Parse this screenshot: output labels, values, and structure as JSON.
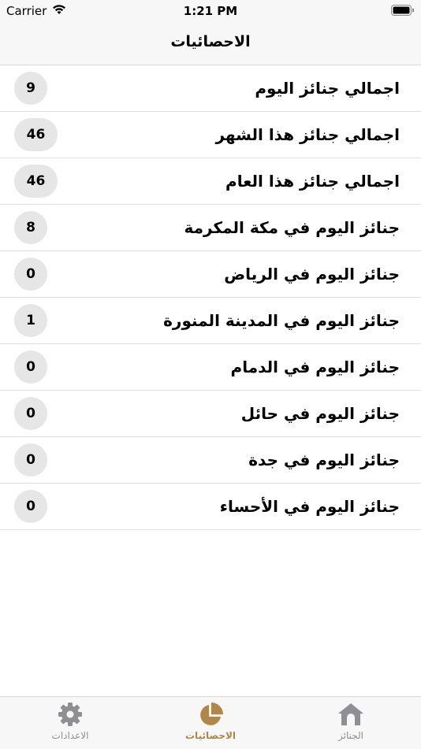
{
  "status_bar": {
    "carrier": "Carrier",
    "time": "1:21 PM"
  },
  "nav": {
    "title": "الاحصائيات"
  },
  "stats": [
    {
      "label": "اجمالي جنائز اليوم",
      "value": "9"
    },
    {
      "label": "اجمالي جنائز هذا الشهر",
      "value": "46"
    },
    {
      "label": "اجمالي جنائز هذا العام",
      "value": "46"
    },
    {
      "label": "جنائز اليوم في مكة المكرمة",
      "value": "8"
    },
    {
      "label": "جنائز اليوم في الرياض",
      "value": "0"
    },
    {
      "label": "جنائز اليوم في المدينة المنورة",
      "value": "1"
    },
    {
      "label": "جنائز اليوم في الدمام",
      "value": "0"
    },
    {
      "label": "جنائز اليوم في حائل",
      "value": "0"
    },
    {
      "label": "جنائز اليوم في جدة",
      "value": "0"
    },
    {
      "label": "جنائز اليوم في الأحساء",
      "value": "0"
    }
  ],
  "tabs": [
    {
      "label": "الاعدادات",
      "icon": "gear-icon"
    },
    {
      "label": "الاحصائيات",
      "icon": "pie-chart-icon",
      "active": true
    },
    {
      "label": "الجنائز",
      "icon": "home-icon"
    }
  ],
  "colors": {
    "accent": "#b0864a",
    "inactive": "#8e8e93",
    "badge": "#e6e6e6"
  }
}
